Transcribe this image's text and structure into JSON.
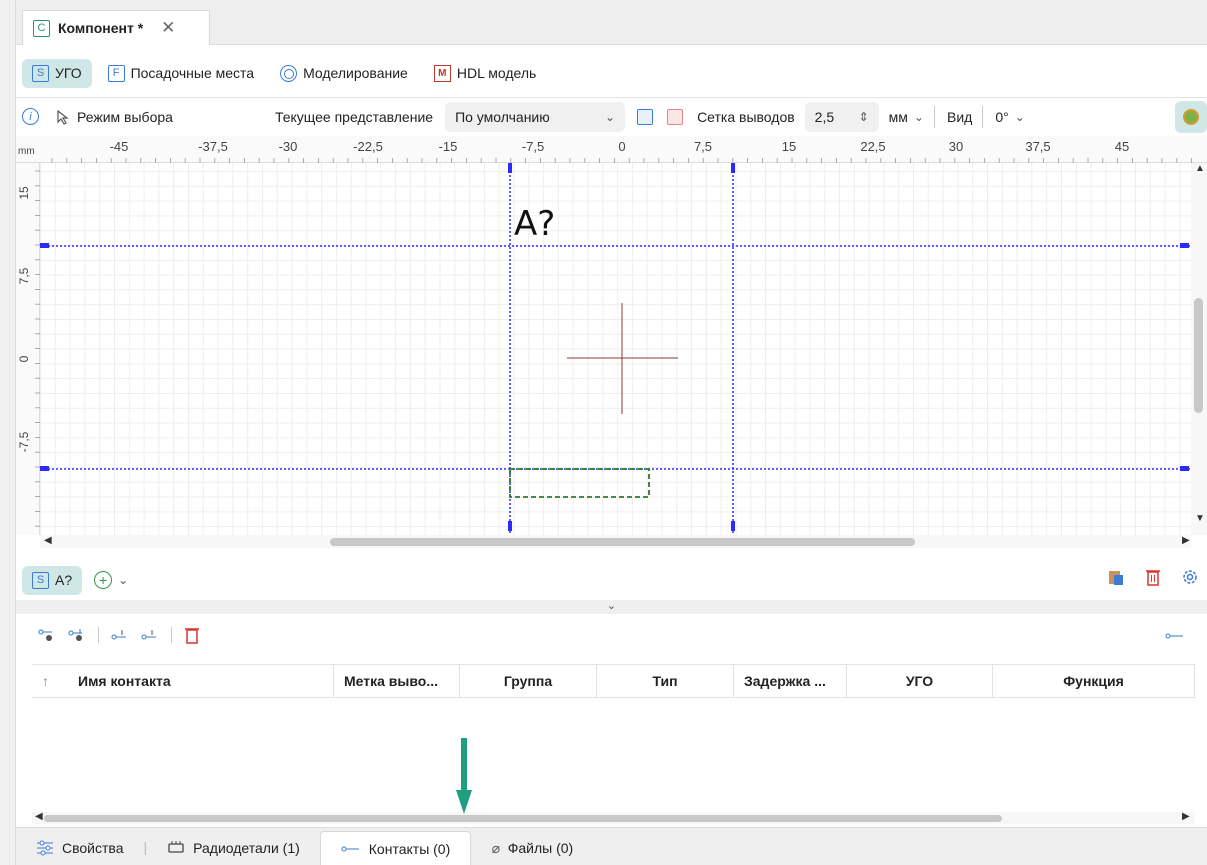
{
  "doc_tab": {
    "badge": "C",
    "title": "Компонент *",
    "close": "✕"
  },
  "view_tabs": [
    {
      "badge": "S",
      "label": "УГО"
    },
    {
      "badge": "F",
      "label": "Посадочные места"
    },
    {
      "badge": "",
      "label": "Моделирование"
    },
    {
      "badge": "M",
      "label": "HDL модель"
    }
  ],
  "toolbar": {
    "info": "i",
    "select_mode": "Режим выбора",
    "current_view_label": "Текущее представление",
    "current_view_value": "По умолчанию",
    "pin_grid_label": "Сетка выводов",
    "pin_grid_value": "2,5",
    "unit": "мм",
    "view_label": "Вид",
    "rotation": "0°"
  },
  "ruler": {
    "unit": "mm",
    "x_ticks": [
      "-45",
      "-37,5",
      "-30",
      "-22,5",
      "-15",
      "-7,5",
      "0",
      "7,5",
      "15",
      "22,5",
      "30",
      "37,5",
      "45"
    ],
    "y_ticks": [
      "15",
      "7,5",
      "0",
      "-7,5"
    ]
  },
  "canvas": {
    "designator": "A?"
  },
  "component_bar": {
    "badge": "S",
    "label": "A?"
  },
  "collapse_label": "⌄",
  "contacts_table": {
    "columns": [
      "Имя контакта",
      "Метка выво...",
      "Группа",
      "Тип",
      "Задержка ...",
      "УГО",
      "Функция"
    ],
    "sort_icon": "↑",
    "rows": []
  },
  "bottom_tabs": [
    {
      "label": "Свойства"
    },
    {
      "label": "Радиодетали (1)"
    },
    {
      "label": "Контакты (0)"
    },
    {
      "label": "Файлы (0)"
    }
  ],
  "colors": {
    "accent": "#cfe7e6",
    "highlight_arrow": "#1f9f80",
    "guide_line": "#2b2bff",
    "origin_cross": "#8b3a3a"
  }
}
